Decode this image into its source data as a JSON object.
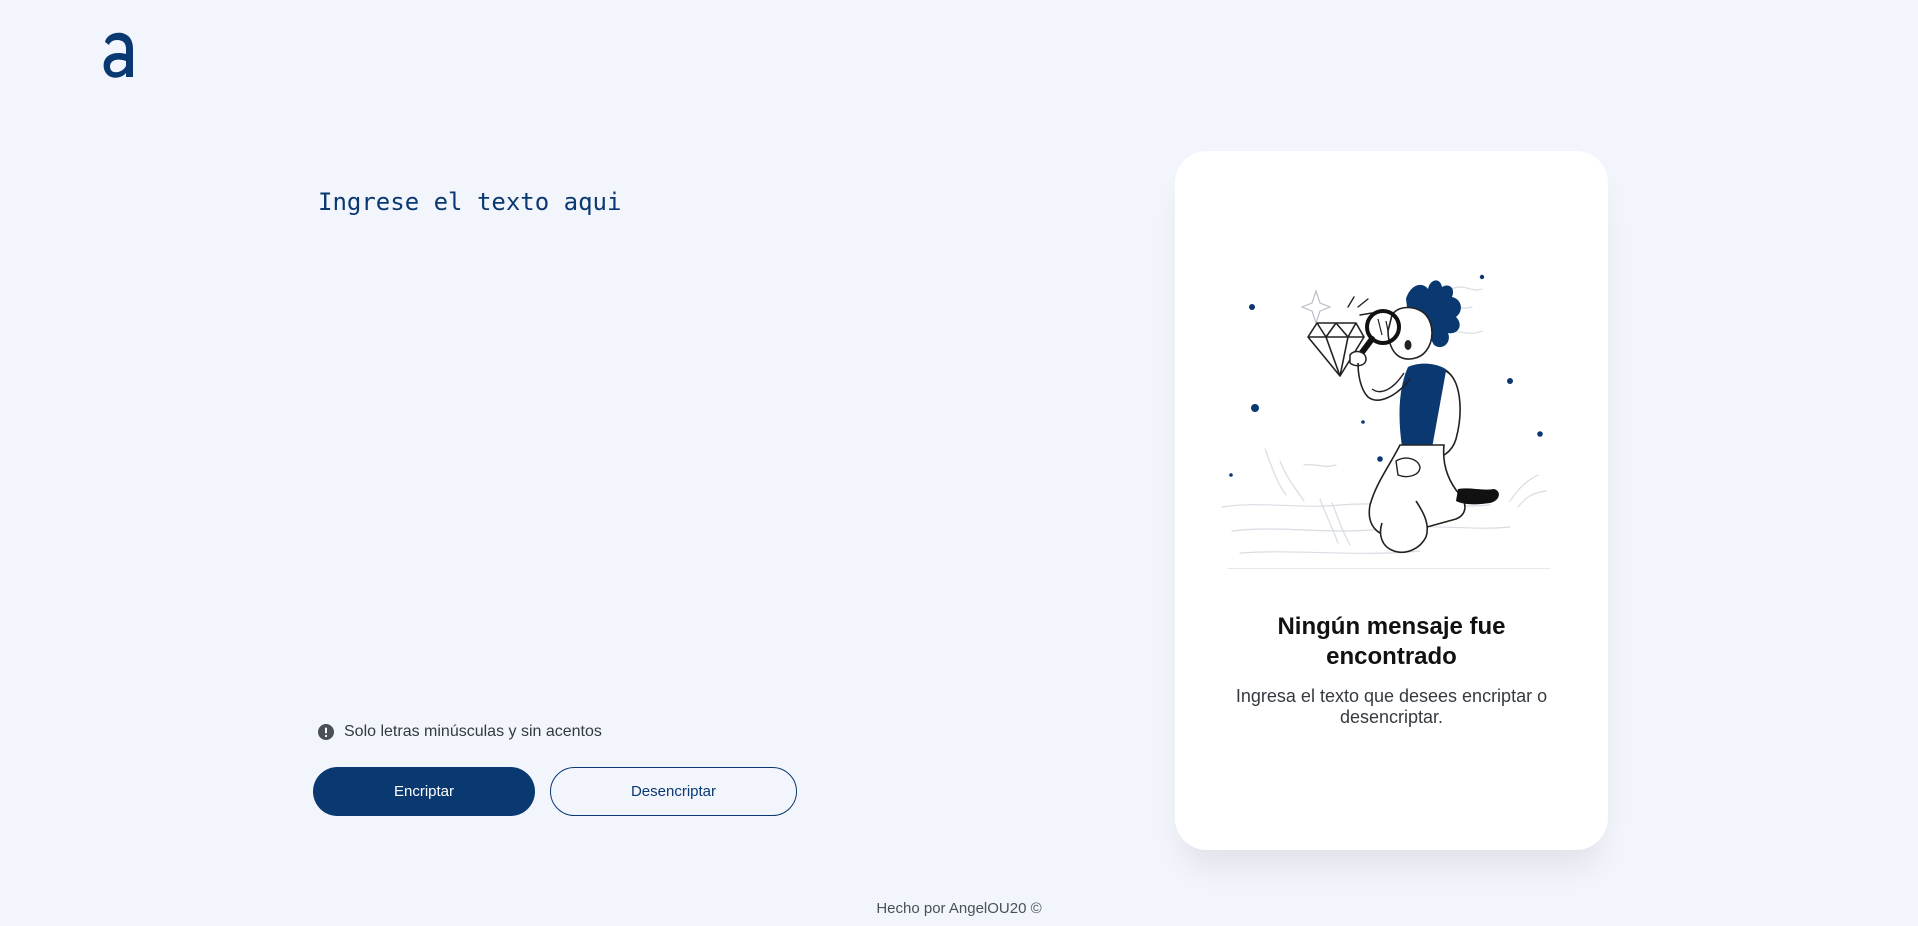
{
  "app": {
    "logo_letter": "a",
    "brand_color": "#0a3871",
    "background_color": "#f3f5fc"
  },
  "editor": {
    "placeholder": "Ingrese el texto aqui",
    "value": ""
  },
  "hint": {
    "icon": "exclamation-circle-icon",
    "text": "Solo letras minúsculas y sin acentos"
  },
  "actions": {
    "encrypt_label": "Encriptar",
    "decrypt_label": "Desencriptar"
  },
  "result": {
    "illustration": "person-with-magnifying-glass-and-diamond",
    "title_line1": "Ningún mensaje fue",
    "title_line2": "encontrado",
    "description": "Ingresa el texto que desees encriptar o desencriptar."
  },
  "footer": {
    "text": "Hecho por AngelOU20 ©"
  }
}
